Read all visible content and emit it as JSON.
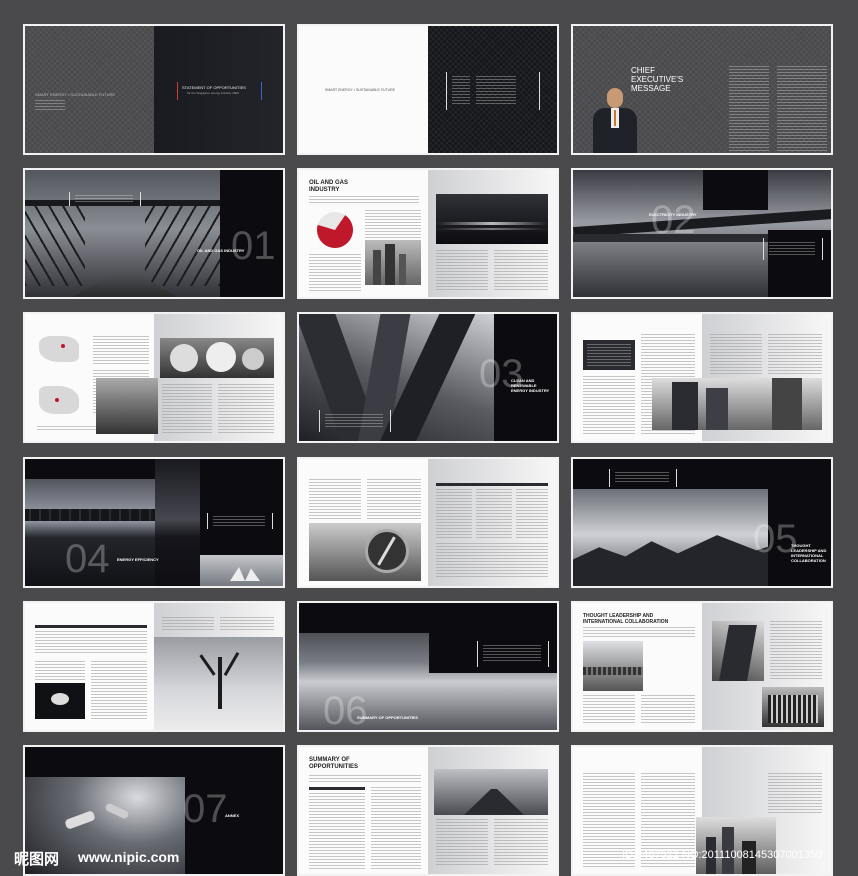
{
  "spreads": {
    "s1": {
      "left_text": "SMART ENERGY • SUSTAINABLE FUTURE",
      "right_title": "STATEMENT OF OPPORTUNITIES",
      "right_sub": "for the Singapore energy industry 2009"
    },
    "s2": {
      "left_text": "SMART ENERGY • SUSTAINABLE FUTURE"
    },
    "s3": {
      "title_line1": "CHIEF",
      "title_line2": "EXECUTIVE'S",
      "title_line3": "MESSAGE"
    },
    "s4": {
      "number": "01",
      "label": "OIL AND GAS INDUSTRY"
    },
    "s5": {
      "title_line1": "OIL AND GAS",
      "title_line2": "INDUSTRY"
    },
    "s6": {
      "number": "02",
      "label": "ELECTRICITY INDUSTRY"
    },
    "s8": {
      "number": "03",
      "label_line1": "CLEAN AND RENEWABLE",
      "label_line2": "ENERGY INDUSTRY"
    },
    "s10": {
      "number": "04",
      "label": "ENERGY EFFICIENCY"
    },
    "s12": {
      "number": "05",
      "label_line1": "THOUGHT",
      "label_line2": "LEADERSHIP AND",
      "label_line3": "INTERNATIONAL",
      "label_line4": "COLLABORATION"
    },
    "s14": {
      "number": "06",
      "label": "SUMMARY OF OPPORTUNITIES"
    },
    "s15": {
      "title_line1": "THOUGHT LEADERSHIP AND",
      "title_line2": "INTERNATIONAL COLLABORATION"
    },
    "s16": {
      "number": "07",
      "label": "ANNEX"
    },
    "s17": {
      "title_line1": "SUMMARY OF",
      "title_line2": "OPPORTUNITIES"
    }
  },
  "watermark": {
    "logo": "昵图网",
    "site": "www.nipic.com",
    "id_text": "ID:5467522 NO:20111008145307001350"
  },
  "colors": {
    "red_chart": "#c0182b",
    "dark": "#16171b"
  },
  "chart_data": {
    "type": "pie",
    "title": "",
    "values": [
      70,
      30
    ],
    "colors": [
      "#c0182b",
      "#e7e7e7"
    ]
  }
}
